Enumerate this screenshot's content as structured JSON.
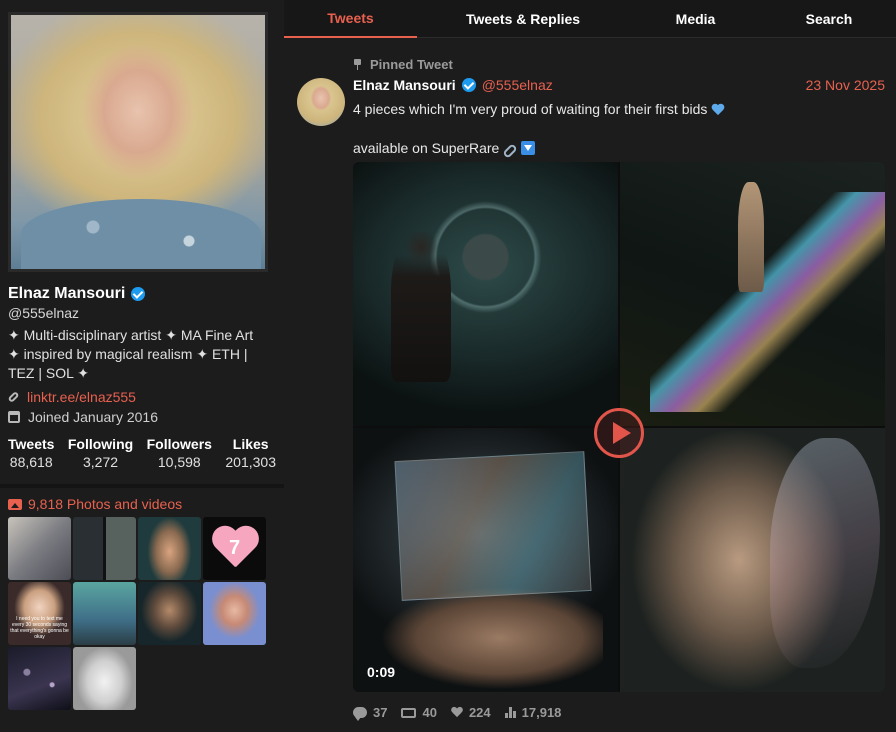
{
  "profile": {
    "name": "Elnaz Mansouri",
    "handle": "@555elnaz",
    "bio_lines": [
      "✦ Multi-disciplinary artist ✦ MA Fine Art",
      "✦ inspired by magical realism ✦ ETH |",
      "TEZ | SOL ✦"
    ],
    "link": "linktr.ee/elnaz555",
    "joined": "Joined January 2016",
    "avatar_icon": "profile-photo",
    "verified_color": "#1d9bf0",
    "stats": [
      {
        "label": "Tweets",
        "value": "88,618"
      },
      {
        "label": "Following",
        "value": "3,272"
      },
      {
        "label": "Followers",
        "value": "10,598"
      },
      {
        "label": "Likes",
        "value": "201,303"
      }
    ]
  },
  "media_panel": {
    "title": "9,818 Photos and videos",
    "heart_number": "7",
    "meme_caption": "I need you to text me every 30 seconds saying that everything's gonna be okay"
  },
  "tabs": [
    "Tweets",
    "Tweets & Replies",
    "Media",
    "Search"
  ],
  "active_tab": "Tweets",
  "tweet": {
    "pinned_label": "Pinned Tweet",
    "author_name": "Elnaz Mansouri",
    "author_handle": "@555elnaz",
    "date": "23 Nov 2025",
    "text_line1": "4 pieces which I'm very proud of waiting for their first bids",
    "text_line2": "available on SuperRare",
    "video_duration": "0:09",
    "replies": "37",
    "retweets": "40",
    "likes": "224",
    "views": "17,918"
  },
  "colors": {
    "accent": "#e8614f",
    "background": "#141414",
    "panel": "#1c1c1c"
  }
}
